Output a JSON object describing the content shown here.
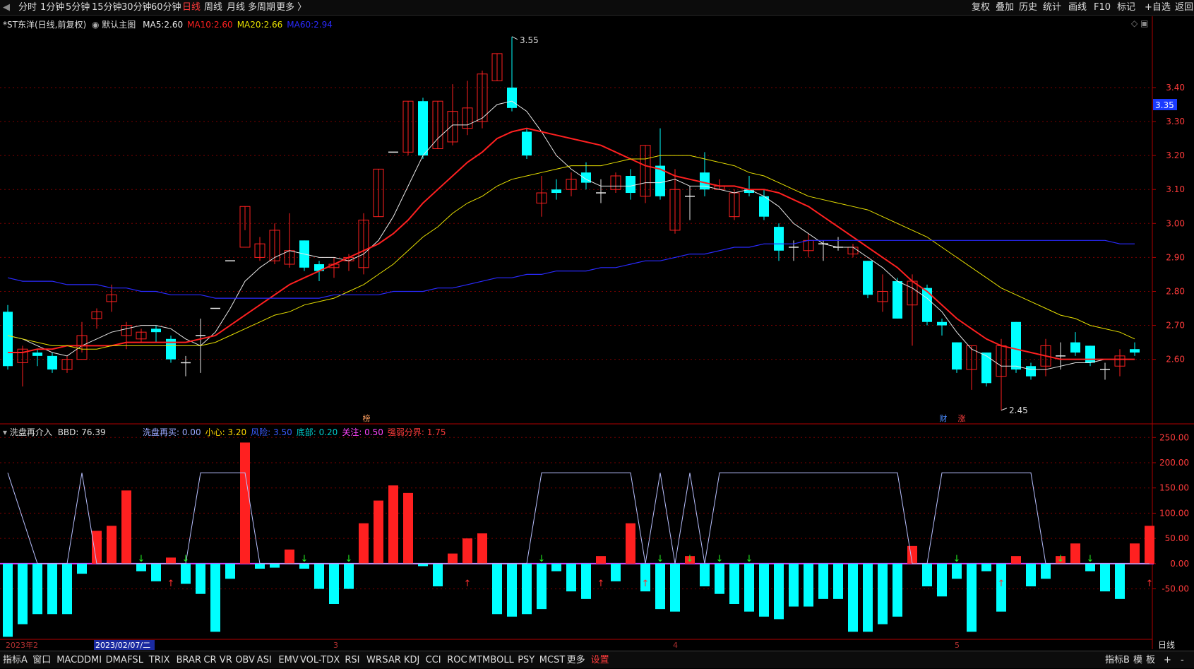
{
  "topbar": {
    "back_icon": "chevron-left-icon",
    "timeframes": [
      "分时",
      "1分钟",
      "5分钟",
      "15分钟",
      "30分钟",
      "60分钟",
      "日线",
      "周线",
      "月线",
      "多周期",
      "更多 〉"
    ],
    "active_timeframe": "日线",
    "right_buttons": [
      "复权",
      "叠加",
      "历史",
      "统计",
      "画线",
      "F10",
      "标记",
      "+自选",
      "返回"
    ]
  },
  "main_header": {
    "stock": "*ST东洋(日线,前复权)",
    "circle_icon": "settings-circle-icon",
    "template": "默认主图",
    "ma": [
      {
        "label": "MA5:",
        "value": "2.60",
        "color": "#e8e8e8"
      },
      {
        "label": "MA10:",
        "value": "2.60",
        "color": "#ff2020"
      },
      {
        "label": "MA20:",
        "value": "2.66",
        "color": "#e8e000"
      },
      {
        "label": "MA60:",
        "value": "2.94",
        "color": "#2a2aff"
      }
    ],
    "corner_icons": [
      "diamond-icon",
      "window-icon"
    ]
  },
  "sub_header": {
    "name": "洗盘再介入",
    "bbd": "BBD: 76.39",
    "items": [
      {
        "text": "洗盘再买: 0.00",
        "color": "#9aa8ff"
      },
      {
        "text": "小心: 3.20",
        "color": "#ffd700"
      },
      {
        "text": "风险: 3.50",
        "color": "#3a5bff"
      },
      {
        "text": "底部: 0.20",
        "color": "#00c8c8"
      },
      {
        "text": "关注: 0.50",
        "color": "#ff44ff"
      },
      {
        "text": "强弱分界: 1.75",
        "color": "#ff3b3b"
      }
    ]
  },
  "bottombar": {
    "items": [
      "指标A",
      "窗口",
      "MACD",
      "DMI",
      "DMA",
      "FSL",
      "TRIX",
      "BRAR",
      "CR",
      "VR",
      "OBV",
      "ASI",
      "EMV",
      "VOL-TDX",
      "RSI",
      "WR",
      "SAR",
      "KDJ",
      "CCI",
      "ROC",
      "MTM",
      "BOLL",
      "PSY",
      "MCST",
      "更多",
      "设置"
    ],
    "right_items": [
      "指标B",
      "模",
      "板",
      "+",
      "-"
    ]
  },
  "colors": {
    "up": "#ff2020",
    "down": "#00ffff",
    "ma5": "#e8e8e8",
    "ma10": "#ff2020",
    "ma20": "#e8e000",
    "ma60": "#2a2aff",
    "grid": "#7a0000",
    "line": "#b8c0ff"
  },
  "chart_data": [
    {
      "type": "candlestick",
      "yticks": [
        2.6,
        2.7,
        2.8,
        2.9,
        3.0,
        3.1,
        3.2,
        3.3,
        3.4
      ],
      "ylim": [
        2.41,
        3.61
      ],
      "last_price_label": "3.35",
      "annotations": {
        "high": "3.55",
        "low": "2.45",
        "markers": [
          "榜",
          "财",
          "涨"
        ]
      },
      "x_labels": [
        "2023年2",
        "2023/02/07/二",
        "3",
        "4",
        "5"
      ],
      "period_label": "日线",
      "candles": [
        [
          2.74,
          2.58,
          2.76,
          2.57
        ],
        [
          2.59,
          2.63,
          2.64,
          2.52
        ],
        [
          2.62,
          2.61,
          2.63,
          2.58
        ],
        [
          2.61,
          2.57,
          2.62,
          2.56
        ],
        [
          2.57,
          2.6,
          2.61,
          2.56
        ],
        [
          2.6,
          2.67,
          2.71,
          2.62
        ],
        [
          2.72,
          2.74,
          2.75,
          2.69
        ],
        [
          2.77,
          2.79,
          2.82,
          2.74
        ],
        [
          2.67,
          2.7,
          2.71,
          2.63
        ],
        [
          2.66,
          2.68,
          2.69,
          2.65
        ],
        [
          2.69,
          2.68,
          2.7,
          2.65
        ],
        [
          2.66,
          2.6,
          2.67,
          2.59
        ],
        [
          2.59,
          2.59,
          2.61,
          2.55
        ],
        [
          2.67,
          2.67,
          2.72,
          2.56
        ],
        [
          2.75,
          2.75,
          2.75,
          2.75
        ],
        [
          2.89,
          2.89,
          2.89,
          2.89
        ],
        [
          2.93,
          3.05,
          3.05,
          2.98
        ],
        [
          2.9,
          2.94,
          2.96,
          2.89
        ],
        [
          2.89,
          2.98,
          3.0,
          2.88
        ],
        [
          2.88,
          2.92,
          3.03,
          2.87
        ],
        [
          2.95,
          2.87,
          2.95,
          2.86
        ],
        [
          2.88,
          2.86,
          2.89,
          2.83
        ],
        [
          2.87,
          2.88,
          2.9,
          2.84
        ],
        [
          2.89,
          2.9,
          2.91,
          2.86
        ],
        [
          2.87,
          3.01,
          3.03,
          2.85
        ],
        [
          3.02,
          3.16,
          3.16,
          3.02
        ],
        [
          3.21,
          3.21,
          3.21,
          3.21
        ],
        [
          3.21,
          3.36,
          3.36,
          3.2
        ],
        [
          3.36,
          3.2,
          3.37,
          3.19
        ],
        [
          3.22,
          3.36,
          3.36,
          3.22
        ],
        [
          3.24,
          3.33,
          3.41,
          3.23
        ],
        [
          3.28,
          3.34,
          3.42,
          3.26
        ],
        [
          3.3,
          3.44,
          3.45,
          3.28
        ],
        [
          3.42,
          3.5,
          3.5,
          3.42
        ],
        [
          3.4,
          3.34,
          3.55,
          3.33
        ],
        [
          3.27,
          3.2,
          3.28,
          3.19
        ],
        [
          3.06,
          3.09,
          3.14,
          3.02
        ],
        [
          3.1,
          3.09,
          3.13,
          3.07
        ],
        [
          3.1,
          3.13,
          3.15,
          3.08
        ],
        [
          3.15,
          3.12,
          3.18,
          3.1
        ],
        [
          3.09,
          3.09,
          3.13,
          3.06
        ],
        [
          3.1,
          3.14,
          3.15,
          3.09
        ],
        [
          3.14,
          3.09,
          3.16,
          3.07
        ],
        [
          3.08,
          3.23,
          3.23,
          3.06
        ],
        [
          3.17,
          3.08,
          3.28,
          3.07
        ],
        [
          2.98,
          3.1,
          3.16,
          2.97
        ],
        [
          3.08,
          3.08,
          3.11,
          3.01
        ],
        [
          3.15,
          3.1,
          3.21,
          3.08
        ],
        [
          3.1,
          3.11,
          3.13,
          3.1
        ],
        [
          3.02,
          3.09,
          3.1,
          3.01
        ],
        [
          3.1,
          3.09,
          3.14,
          3.08
        ],
        [
          3.08,
          3.02,
          3.1,
          3.01
        ],
        [
          2.99,
          2.92,
          3.0,
          2.89
        ],
        [
          2.93,
          2.93,
          2.95,
          2.89
        ],
        [
          2.92,
          2.95,
          2.97,
          2.9
        ],
        [
          2.94,
          2.94,
          2.95,
          2.89
        ],
        [
          2.93,
          2.93,
          2.96,
          2.92
        ],
        [
          2.91,
          2.93,
          2.94,
          2.9
        ],
        [
          2.89,
          2.79,
          2.89,
          2.78
        ],
        [
          2.77,
          2.8,
          2.85,
          2.74
        ],
        [
          2.83,
          2.72,
          2.84,
          2.72
        ],
        [
          2.76,
          2.83,
          2.85,
          2.64
        ],
        [
          2.81,
          2.71,
          2.82,
          2.7
        ],
        [
          2.71,
          2.7,
          2.72,
          2.67
        ],
        [
          2.65,
          2.57,
          2.65,
          2.56
        ],
        [
          2.57,
          2.64,
          2.64,
          2.51
        ],
        [
          2.62,
          2.53,
          2.62,
          2.52
        ],
        [
          2.55,
          2.64,
          2.66,
          2.45
        ],
        [
          2.71,
          2.57,
          2.71,
          2.56
        ],
        [
          2.58,
          2.55,
          2.59,
          2.54
        ],
        [
          2.58,
          2.64,
          2.66,
          2.55
        ],
        [
          2.61,
          2.61,
          2.65,
          2.57
        ],
        [
          2.65,
          2.62,
          2.68,
          2.61
        ],
        [
          2.64,
          2.59,
          2.64,
          2.58
        ],
        [
          2.57,
          2.57,
          2.59,
          2.54
        ],
        [
          2.58,
          2.61,
          2.63,
          2.55
        ],
        [
          2.63,
          2.62,
          2.65,
          2.61
        ]
      ],
      "ma_lines": {
        "MA5": [
          2.67,
          2.66,
          2.64,
          2.62,
          2.61,
          2.64,
          2.66,
          2.68,
          2.69,
          2.7,
          2.7,
          2.69,
          2.66,
          2.64,
          2.68,
          2.75,
          2.83,
          2.87,
          2.9,
          2.92,
          2.91,
          2.9,
          2.9,
          2.89,
          2.91,
          2.95,
          3.02,
          3.11,
          3.2,
          3.25,
          3.29,
          3.29,
          3.31,
          3.35,
          3.36,
          3.33,
          3.27,
          3.2,
          3.16,
          3.13,
          3.11,
          3.11,
          3.11,
          3.12,
          3.12,
          3.13,
          3.11,
          3.11,
          3.1,
          3.09,
          3.1,
          3.08,
          3.05,
          3.0,
          2.97,
          2.94,
          2.93,
          2.93,
          2.9,
          2.87,
          2.83,
          2.81,
          2.78,
          2.74,
          2.68,
          2.63,
          2.61,
          2.58,
          2.58,
          2.57,
          2.57,
          2.58,
          2.59,
          2.59,
          2.6,
          2.6,
          2.6
        ],
        "MA10": [
          2.62,
          2.62,
          2.63,
          2.63,
          2.64,
          2.64,
          2.64,
          2.64,
          2.65,
          2.65,
          2.65,
          2.65,
          2.65,
          2.66,
          2.67,
          2.7,
          2.73,
          2.76,
          2.79,
          2.82,
          2.84,
          2.86,
          2.88,
          2.9,
          2.92,
          2.94,
          2.97,
          3.01,
          3.06,
          3.1,
          3.14,
          3.18,
          3.21,
          3.25,
          3.27,
          3.28,
          3.27,
          3.26,
          3.25,
          3.24,
          3.23,
          3.21,
          3.19,
          3.17,
          3.16,
          3.14,
          3.13,
          3.12,
          3.11,
          3.11,
          3.1,
          3.1,
          3.09,
          3.07,
          3.05,
          3.02,
          2.99,
          2.96,
          2.93,
          2.9,
          2.87,
          2.83,
          2.8,
          2.76,
          2.72,
          2.69,
          2.66,
          2.64,
          2.63,
          2.62,
          2.61,
          2.6,
          2.6,
          2.6,
          2.6,
          2.6,
          2.6
        ],
        "MA20": [
          2.67,
          2.66,
          2.65,
          2.64,
          2.64,
          2.63,
          2.63,
          2.64,
          2.64,
          2.64,
          2.64,
          2.64,
          2.64,
          2.64,
          2.65,
          2.67,
          2.69,
          2.71,
          2.73,
          2.74,
          2.76,
          2.77,
          2.78,
          2.8,
          2.82,
          2.85,
          2.88,
          2.92,
          2.96,
          2.99,
          3.03,
          3.06,
          3.08,
          3.11,
          3.13,
          3.14,
          3.15,
          3.16,
          3.17,
          3.17,
          3.17,
          3.18,
          3.19,
          3.19,
          3.2,
          3.2,
          3.2,
          3.19,
          3.18,
          3.17,
          3.15,
          3.14,
          3.12,
          3.1,
          3.08,
          3.07,
          3.06,
          3.05,
          3.04,
          3.02,
          3.0,
          2.98,
          2.96,
          2.93,
          2.9,
          2.87,
          2.84,
          2.81,
          2.79,
          2.77,
          2.75,
          2.73,
          2.72,
          2.7,
          2.69,
          2.68,
          2.66
        ],
        "MA60": [
          2.84,
          2.83,
          2.83,
          2.83,
          2.82,
          2.82,
          2.82,
          2.81,
          2.81,
          2.8,
          2.8,
          2.79,
          2.79,
          2.79,
          2.78,
          2.78,
          2.78,
          2.78,
          2.78,
          2.78,
          2.78,
          2.78,
          2.79,
          2.79,
          2.79,
          2.79,
          2.8,
          2.8,
          2.8,
          2.81,
          2.81,
          2.82,
          2.83,
          2.84,
          2.84,
          2.85,
          2.85,
          2.86,
          2.86,
          2.86,
          2.87,
          2.87,
          2.88,
          2.89,
          2.89,
          2.9,
          2.91,
          2.91,
          2.92,
          2.93,
          2.93,
          2.94,
          2.94,
          2.94,
          2.95,
          2.95,
          2.95,
          2.95,
          2.95,
          2.95,
          2.95,
          2.95,
          2.95,
          2.95,
          2.95,
          2.95,
          2.95,
          2.95,
          2.95,
          2.95,
          2.95,
          2.95,
          2.95,
          2.95,
          2.95,
          2.94,
          2.94
        ]
      }
    },
    {
      "type": "bar",
      "yticks": [
        -50,
        0,
        50,
        100,
        150,
        200,
        250
      ],
      "ylim": [
        -150,
        270
      ],
      "bars": [
        -145,
        -120,
        -100,
        -100,
        -100,
        -20,
        65,
        75,
        145,
        -15,
        -35,
        12,
        -40,
        -60,
        -135,
        -30,
        240,
        -10,
        -8,
        28,
        -10,
        -50,
        -80,
        -50,
        80,
        125,
        155,
        140,
        -5,
        -45,
        20,
        50,
        60,
        -100,
        -105,
        -100,
        -90,
        -15,
        -55,
        -70,
        15,
        -35,
        80,
        -55,
        -90,
        -95,
        15,
        -45,
        -60,
        -80,
        -95,
        -105,
        -110,
        -85,
        -85,
        -70,
        -70,
        -135,
        -135,
        -120,
        -105,
        35,
        -45,
        -65,
        -30,
        -135,
        -15,
        -95,
        15,
        -45,
        -30,
        15,
        40,
        -15,
        -55,
        -70,
        40,
        75
      ],
      "line": [
        180,
        90,
        0,
        0,
        0,
        180,
        0,
        0,
        0,
        0,
        0,
        0,
        0,
        180,
        180,
        180,
        180,
        0,
        0,
        0,
        0,
        0,
        0,
        0,
        0,
        0,
        0,
        0,
        0,
        0,
        0,
        0,
        0,
        0,
        0,
        0,
        180,
        180,
        180,
        180,
        180,
        180,
        180,
        0,
        180,
        0,
        180,
        0,
        180,
        180,
        180,
        180,
        180,
        180,
        180,
        180,
        180,
        180,
        180,
        180,
        180,
        0,
        0,
        180,
        180,
        180,
        180,
        180,
        180,
        180,
        0,
        0,
        0,
        0,
        0,
        0,
        0,
        0
      ],
      "buy_arrows": [
        11,
        31,
        40,
        43,
        67,
        77
      ],
      "sell_arrows": [
        9,
        12,
        20,
        23,
        36,
        44,
        46,
        48,
        50,
        64,
        71,
        73,
        81
      ]
    }
  ]
}
